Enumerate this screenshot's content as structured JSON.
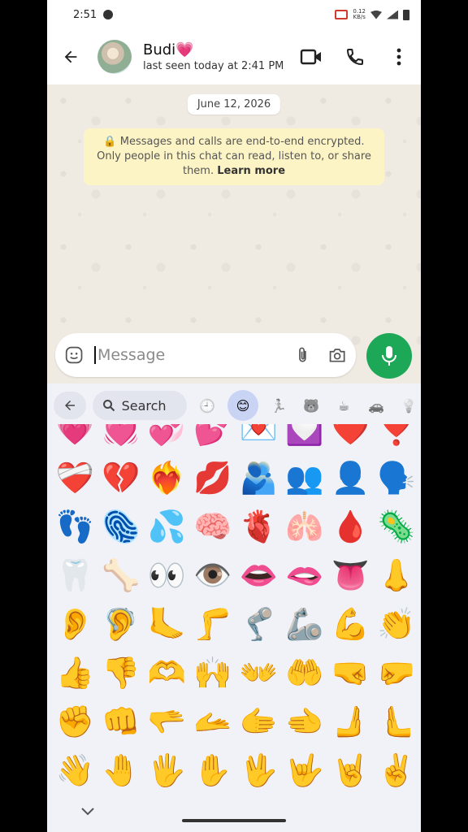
{
  "status_bar": {
    "time": "2:51",
    "speed_top": "0.12",
    "speed_bottom": "KB/s"
  },
  "contact": {
    "name": "Budi💗",
    "last_seen": "last seen today at 2:41 PM"
  },
  "chat": {
    "date_chip": "June 12, 2026",
    "e2e_notice": "🔒 Messages and calls are end-to-end encrypted. Only people in this chat can read, listen to, or share them.",
    "e2e_link": "Learn more"
  },
  "composer": {
    "placeholder": "Message"
  },
  "emoji_keyboard": {
    "search_label": "Search",
    "categories": [
      "🕘",
      "😊",
      "🏃",
      "🐻",
      "☕",
      "🚗",
      "💡"
    ],
    "rows": [
      [
        "💗",
        "💓",
        "💞",
        "💕",
        "💌",
        "💟",
        "❤️",
        "❣️"
      ],
      [
        "❤️‍🩹",
        "💔",
        "❤️‍🔥",
        "💋",
        "🫂",
        "👥",
        "👤",
        "🗣️"
      ],
      [
        "👣",
        "🫆",
        "💦",
        "🧠",
        "🫀",
        "🫁",
        "🩸",
        "🦠"
      ],
      [
        "🦷",
        "🦴",
        "👀",
        "👁️",
        "👄",
        "🫦",
        "👅",
        "👃"
      ],
      [
        "👂",
        "🦻",
        "🦶",
        "🦵",
        "🦿",
        "🦾",
        "💪",
        "👏"
      ],
      [
        "👍",
        "👎",
        "🫶",
        "🙌",
        "👐",
        "🤲",
        "🤜",
        "🤛"
      ],
      [
        "✊",
        "👊",
        "🫳",
        "🫴",
        "🫱",
        "🫲",
        "🫸",
        "🫷"
      ],
      [
        "👋",
        "🤚",
        "🖐️",
        "✋",
        "🖖",
        "🤟",
        "🤘",
        "✌️"
      ]
    ]
  }
}
